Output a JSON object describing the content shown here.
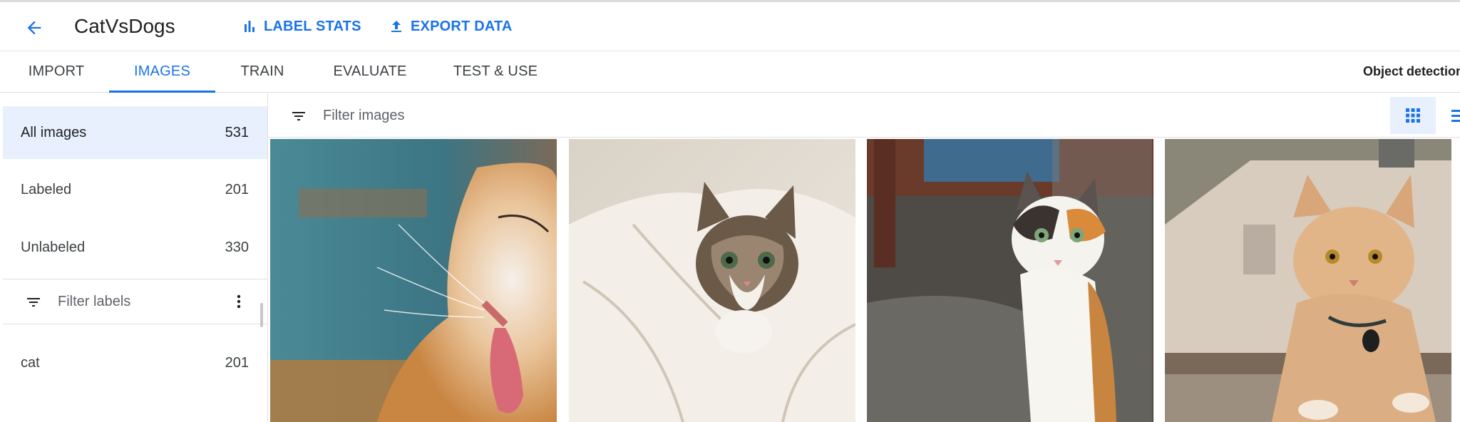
{
  "header": {
    "back_icon": "arrow-back-icon",
    "title": "CatVsDogs",
    "label_stats": "LABEL STATS",
    "label_stats_icon": "bar-chart-icon",
    "export_data": "EXPORT DATA",
    "export_icon": "upload-icon",
    "accent_color": "#1a73e8"
  },
  "tabs": [
    {
      "label": "IMPORT",
      "active": false
    },
    {
      "label": "IMAGES",
      "active": true
    },
    {
      "label": "TRAIN",
      "active": false
    },
    {
      "label": "EVALUATE",
      "active": false
    },
    {
      "label": "TEST & USE",
      "active": false
    }
  ],
  "model_type": "Object detection",
  "sidebar": {
    "items": [
      {
        "label": "All images",
        "count": "531",
        "selected": true
      },
      {
        "label": "Labeled",
        "count": "201",
        "selected": false
      },
      {
        "label": "Unlabeled",
        "count": "330",
        "selected": false
      }
    ],
    "filter_placeholder": "Filter labels",
    "filter_icon": "filter-list-icon",
    "more_icon": "more-vert-icon",
    "labels": [
      {
        "label": "cat",
        "count": "201"
      }
    ]
  },
  "main": {
    "filter_placeholder": "Filter images",
    "filter_icon": "filter-list-icon",
    "grid_view_icon": "grid-view-icon",
    "list_view_icon": "list-view-icon",
    "images": [
      {
        "subject": "orange-white cat licking"
      },
      {
        "subject": "tabby kitten in blanket"
      },
      {
        "subject": "calico cat outdoors"
      },
      {
        "subject": "orange cat with collar tag"
      }
    ]
  }
}
